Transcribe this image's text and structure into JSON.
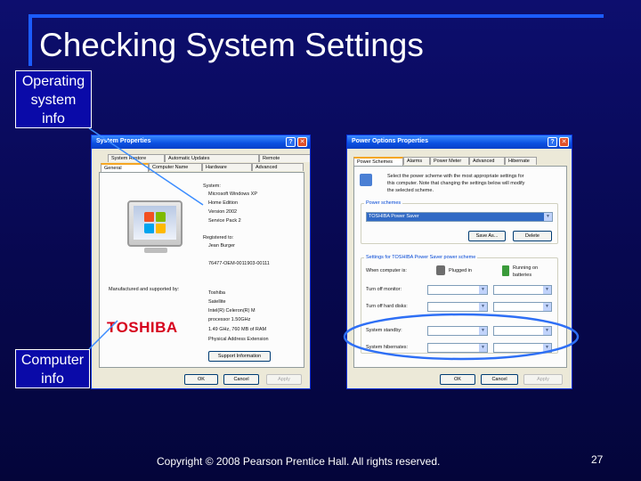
{
  "slide": {
    "title": "Checking System Settings",
    "callout_os": "Operating\nsystem\ninfo",
    "callout_computer": "Computer\ninfo",
    "footer": "Copyright © 2008 Pearson Prentice Hall. All rights reserved.",
    "page_number": "27"
  },
  "colors": {
    "background": "#07084f",
    "frame_accent": "#1b5cff",
    "callout_fill": "#0a0aa8",
    "highlight_ellipse": "#2e6ff5",
    "oem_logo": "#d6001c"
  },
  "system_properties": {
    "title": "System Properties",
    "tabs_row1": [
      "System Restore",
      "Automatic Updates",
      "Remote"
    ],
    "tabs_row2": [
      "General",
      "Computer Name",
      "Hardware",
      "Advanced"
    ],
    "system_heading": "System:",
    "system_lines": [
      "Microsoft Windows XP",
      "Home Edition",
      "Version 2002",
      "Service Pack 2"
    ],
    "registered_heading": "Registered to:",
    "registered_lines": [
      "Jean Burger",
      "",
      "76477-OEM-0011903-00111"
    ],
    "manufactured_label": "Manufactured and supported by:",
    "oem_logo": "TOSHIBA",
    "computer_lines": [
      "Toshiba",
      "Satellite",
      "Intel(R) Celeron(R) M",
      "processor      1.50GHz",
      "1.49 GHz, 760 MB of RAM",
      "Physical Address Extension"
    ],
    "support_button": "Support Information",
    "ok": "OK",
    "cancel": "Cancel",
    "apply": "Apply"
  },
  "power_options": {
    "title": "Power Options Properties",
    "tabs": [
      "Power Schemes",
      "Alarms",
      "Power Meter",
      "Advanced",
      "Hibernate"
    ],
    "intro": [
      "Select the power scheme with the most appropriate settings for",
      "this computer. Note that changing the settings below will modify",
      "the selected scheme."
    ],
    "schemes_label": "Power schemes",
    "scheme_value": "TOSHIBA Power Saver",
    "save_as": "Save As...",
    "delete": "Delete",
    "settings_label": "Settings for TOSHIBA Power Saver power scheme",
    "when_label": "When computer is:",
    "col_plugged": "Plugged in",
    "col_battery": "Running on batteries",
    "rows": [
      {
        "label": "Turn off monitor:",
        "plugged": "After 5 mins",
        "battery": "After 3 mins"
      },
      {
        "label": "Turn off hard disks:",
        "plugged": "After 3 mins",
        "battery": "After 3 mins"
      },
      {
        "label": "System standby:",
        "plugged": "After 5 mins",
        "battery": "After 1 mins"
      },
      {
        "label": "System hibernates:",
        "plugged": "Never",
        "battery": "Never"
      }
    ],
    "ok": "OK",
    "cancel": "Cancel",
    "apply": "Apply"
  }
}
